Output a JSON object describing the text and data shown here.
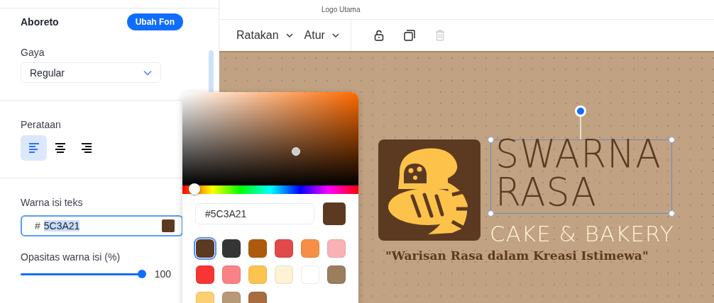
{
  "panel": {
    "font_name": "Aboreto",
    "change_font_button": "Ubah Fon",
    "style": {
      "label": "Gaya",
      "value": "Regular"
    },
    "alignment": {
      "label": "Perataan",
      "options": [
        {
          "kind": "left",
          "selected": true
        },
        {
          "kind": "center",
          "selected": false
        },
        {
          "kind": "right",
          "selected": false
        }
      ]
    },
    "fill_color": {
      "label": "Warna isi teks",
      "hash": "#",
      "value": "5C3A21",
      "color": "#5c3a21"
    },
    "opacity": {
      "label": "Opasitas warna isi (%)",
      "level": 1,
      "reading": "100"
    }
  },
  "top_label": "Logo Utama",
  "toolbar": {
    "menus": [
      "Ratakan",
      "Atur"
    ],
    "tools": [
      {
        "kind": "lock",
        "disabled": false
      },
      {
        "kind": "duplicate",
        "disabled": false
      },
      {
        "kind": "delete",
        "disabled": true
      }
    ]
  },
  "color_picker": {
    "hue": {
      "level": 0.04
    },
    "hex": "#5C3A21",
    "swatches": [
      {
        "color": "#5c3a21",
        "selected": true
      },
      {
        "color": "#353535",
        "selected": false
      },
      {
        "color": "#ae5a0c",
        "selected": false
      },
      {
        "color": "#e2494a",
        "selected": false
      },
      {
        "color": "#f68f45",
        "selected": false
      },
      {
        "color": "#f9b1b5",
        "selected": false
      },
      {
        "color": "#f93434",
        "selected": false
      },
      {
        "color": "#f88285",
        "selected": false
      },
      {
        "color": "#fbc44e",
        "selected": false
      },
      {
        "color": "#fdf2d6",
        "selected": false
      },
      {
        "color": "#ffffff",
        "selected": false
      },
      {
        "color": "#9a7e5e",
        "selected": false
      },
      {
        "color": "#fcd071",
        "selected": false
      },
      {
        "color": "#b99877",
        "selected": false
      },
      {
        "color": "#a86c3f",
        "selected": false
      }
    ]
  },
  "logo": {
    "title_lines": [
      "SWARNA",
      "RASA"
    ],
    "subtitle": "CAKE & BAKERY",
    "tagline": "\"Warisan Rasa dalam Kreasi Istimewa\""
  }
}
